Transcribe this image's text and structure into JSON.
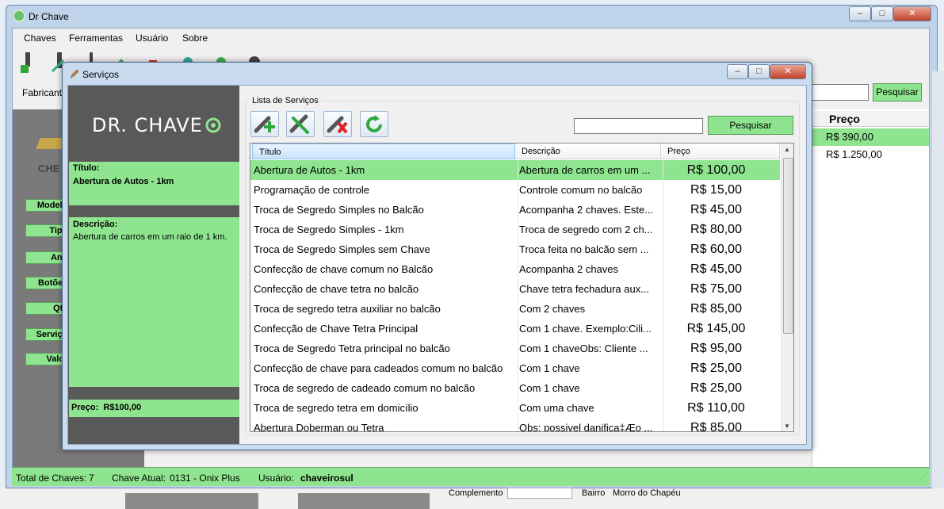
{
  "main": {
    "title": "Dr Chave",
    "menu": [
      "Chaves",
      "Ferramentas",
      "Usuário",
      "Sobre"
    ],
    "fabricante_label": "Fabricante",
    "search_button": "Pesquisar",
    "logo_text_partial": "CHE",
    "fields": [
      "Modelo:",
      "Tipo:",
      "Ano:",
      "Botões:",
      "Qte:",
      "Serviço:",
      "Valor:"
    ],
    "price_header": "Preço",
    "prices": [
      "R$ 390,00",
      "R$ 1.250,00"
    ],
    "status": {
      "total_label": "Total de Chaves:",
      "total_value": "7",
      "atual_label": "Chave Atual:",
      "atual_value": "0131 - Onix Plus",
      "usuario_label": "Usuário:",
      "usuario_value": "chaveirosul"
    },
    "bottom": {
      "complemento": "Complemento",
      "bairro_label": "Bairro",
      "bairro_value": "Morro do Chapéu"
    }
  },
  "dialog": {
    "title": "Serviços",
    "logo": "DR. CHAVE",
    "titulo_label": "Título:",
    "titulo_value": "Abertura de Autos - 1km",
    "descricao_label": "Descrição:",
    "descricao_value": "Abertura de carros em um raio de 1 km.",
    "preco_label": "Preço:",
    "preco_value": "R$100,00",
    "group_label": "Lista de Serviços",
    "search_button": "Pesquisar",
    "columns": [
      "Título",
      "Descrição",
      "Preço"
    ],
    "rows": [
      [
        "Abertura de Autos - 1km",
        "Abertura de carros em um ...",
        "R$ 100,00"
      ],
      [
        "Programação de controle",
        "Controle comum no balcão",
        "R$ 15,00"
      ],
      [
        "Troca de Segredo Simples no Balcão",
        "Acompanha 2 chaves. Este...",
        "R$ 45,00"
      ],
      [
        "Troca de Segredo Simples - 1km",
        "Troca de segredo com 2 ch...",
        "R$ 80,00"
      ],
      [
        "Troca de Segredo Simples sem Chave",
        "Troca feita no balcão sem ...",
        "R$ 60,00"
      ],
      [
        "Confecção de chave comum no Balcão",
        "Acompanha 2 chaves",
        "R$ 45,00"
      ],
      [
        "Confecção de chave tetra no balcão",
        "Chave tetra fechadura aux...",
        "R$ 75,00"
      ],
      [
        "Troca de segredo tetra auxiliar no balcão",
        "Com 2 chaves",
        "R$ 85,00"
      ],
      [
        "Confecção de Chave Tetra Principal",
        "Com 1 chave. Exemplo:Cili...",
        "R$ 145,00"
      ],
      [
        "Troca de Segredo Tetra principal no balcão",
        "Com 1 chaveObs: Cliente ...",
        "R$ 95,00"
      ],
      [
        "Confecção de chave para cadeados comum no balcão",
        "Com 1 chave",
        "R$ 25,00"
      ],
      [
        "Troca de segredo de cadeado comum no balcão",
        "Com 1 chave",
        "R$ 25,00"
      ],
      [
        "Troca de segredo tetra em domicílio",
        "Com uma chave",
        "R$ 110,00"
      ],
      [
        "Abertura Doberman ou Tetra",
        "Obs: possivel danifica‡Æo ...",
        "R$ 85,00"
      ]
    ]
  },
  "icons": {
    "app": "app-logo-icon",
    "pencil": "pencil-icon"
  },
  "colors": {
    "accent_green": "#8fe58f",
    "panel_gray": "#595959"
  }
}
